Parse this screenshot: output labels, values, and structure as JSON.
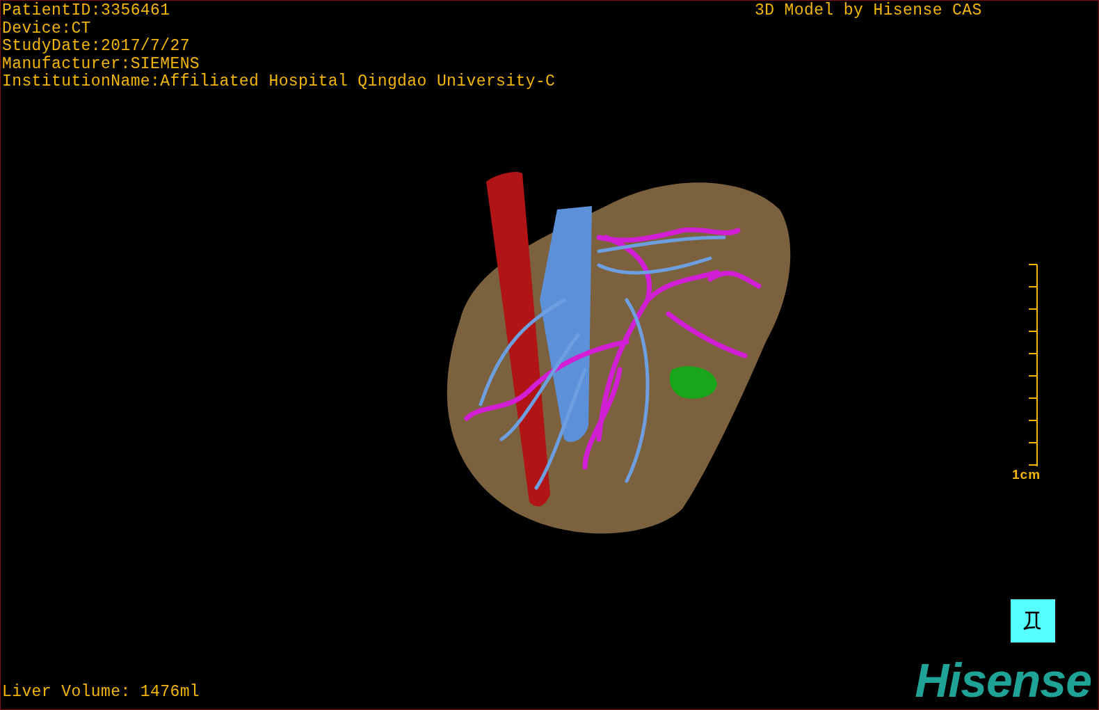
{
  "patient_info": [
    "PatientID:3356461",
    "Device:CT",
    "StudyDate:2017/7/27",
    "Manufacturer:SIEMENS",
    "InstitutionName:Affiliated Hospital Qingdao University-C"
  ],
  "model_credit": "3D Model by Hisense CAS",
  "scale_bar": {
    "label": "1cm"
  },
  "liver_volume": "Liver Volume: 1476ml",
  "logo": "Hisense"
}
